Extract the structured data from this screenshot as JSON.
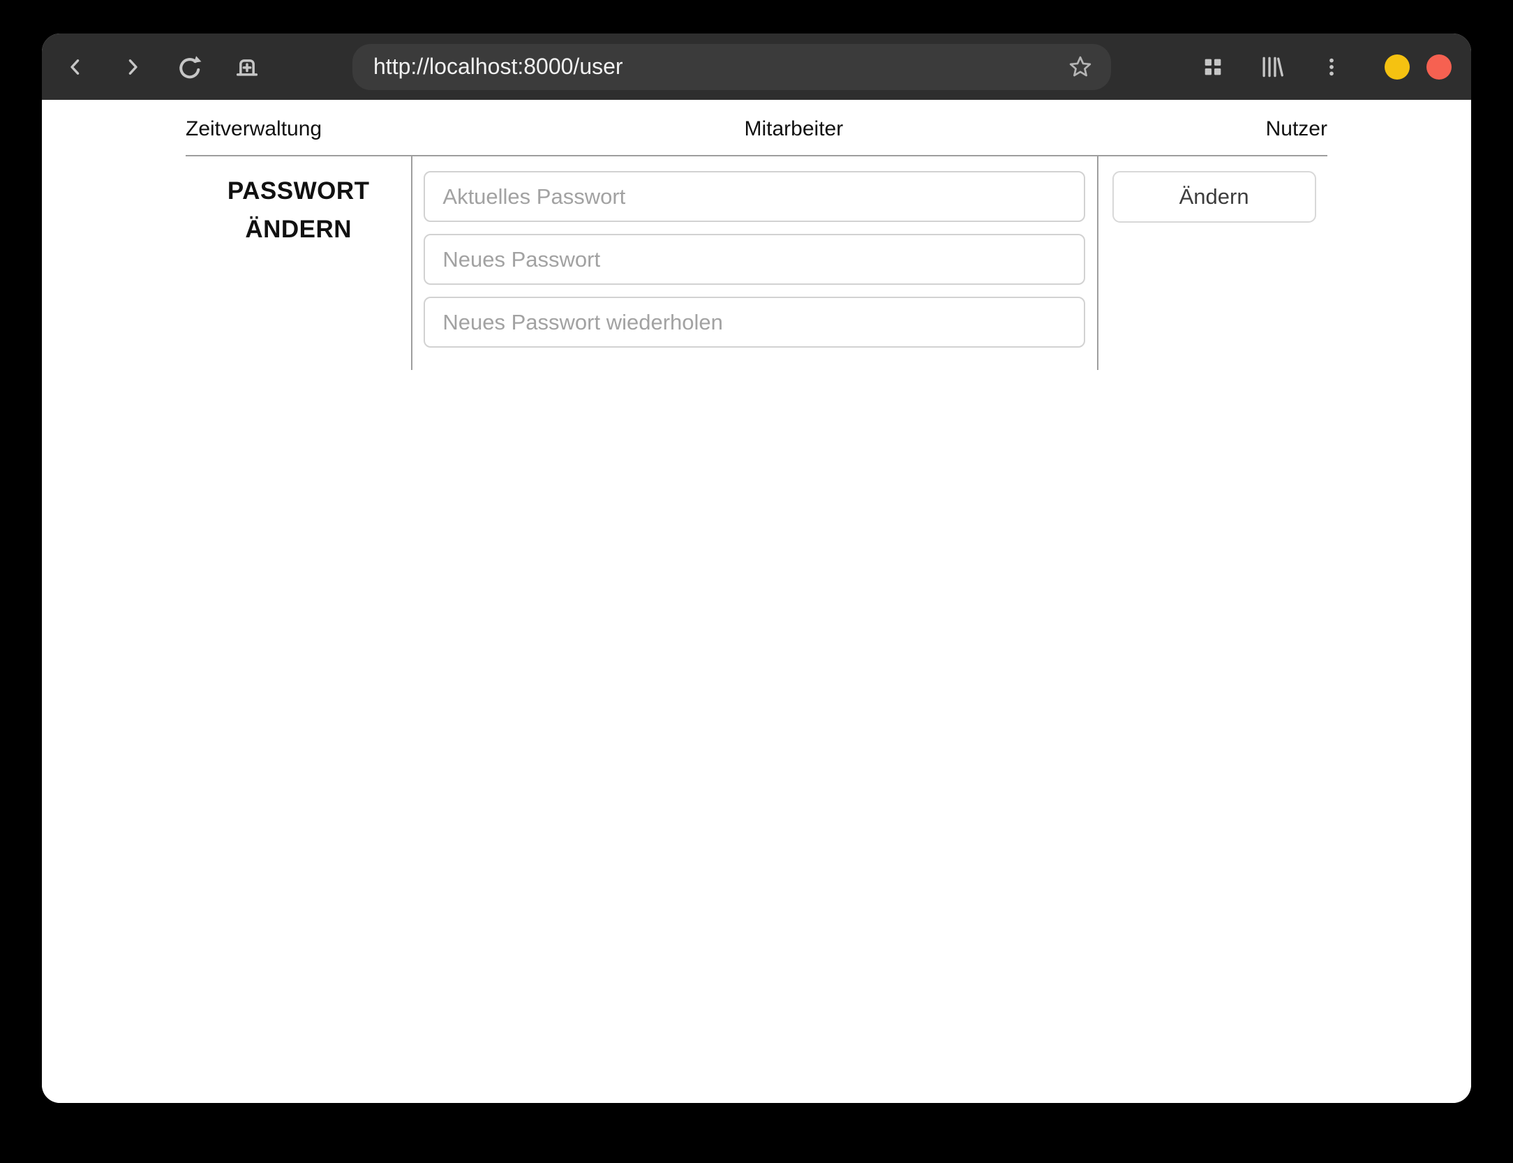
{
  "browser": {
    "url": "http://localhost:8000/user",
    "toolbar_icons": [
      "back-icon",
      "forward-icon",
      "reload-icon",
      "new-tab-icon",
      "bookmark-star-icon",
      "tab-overview-icon",
      "library-icon",
      "menu-kebab-icon"
    ],
    "window_controls": [
      {
        "name": "minimize",
        "color": "#f5c211"
      },
      {
        "name": "close",
        "color": "#f66151"
      }
    ]
  },
  "nav": {
    "items": [
      "Zeitverwaltung",
      "Mitarbeiter",
      "Nutzer"
    ]
  },
  "password_section": {
    "heading": "PASSWORT ÄNDERN",
    "fields": [
      {
        "placeholder": "Aktuelles Passwort"
      },
      {
        "placeholder": "Neues Passwort"
      },
      {
        "placeholder": "Neues Passwort wiederholen"
      }
    ],
    "submit_label": "Ändern"
  },
  "colors": {
    "outside_background": "#000000",
    "titlebar": "#2e2e2e",
    "urlbar": "#3b3b3b",
    "page_background": "#ffffff",
    "divider": "#9e9e9e",
    "input_border": "#d2d2d2",
    "placeholder_text": "#a2a2a2",
    "minimize_button": "#f5c211",
    "close_button": "#f66151"
  }
}
